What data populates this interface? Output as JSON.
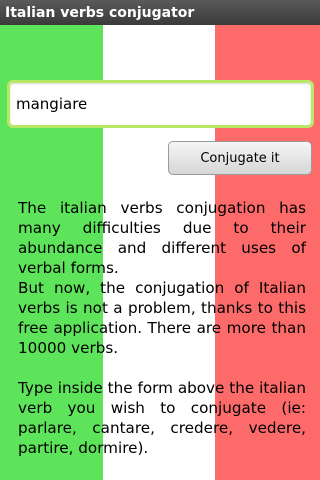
{
  "app": {
    "title": "Italian verbs conjugator"
  },
  "form": {
    "verb_value": "mangiare",
    "conjugate_label": "Conjugate it"
  },
  "description": {
    "para1": "The italian verbs conjugation has many difficulties due to their abundance and different uses of verbal forms.",
    "para2": "But now, the conjugation of Italian verbs is not a problem, thanks to this free application. There are more than 10000 verbs.",
    "para3": "Type inside the form above the italian verb you wish to conjugate (ie: parlare, cantare, credere, vedere, partire, dormire)."
  },
  "colors": {
    "flag_green": "#5ee45a",
    "flag_white": "#ffffff",
    "flag_red": "#fd6a6a",
    "input_border": "#b7e868"
  }
}
